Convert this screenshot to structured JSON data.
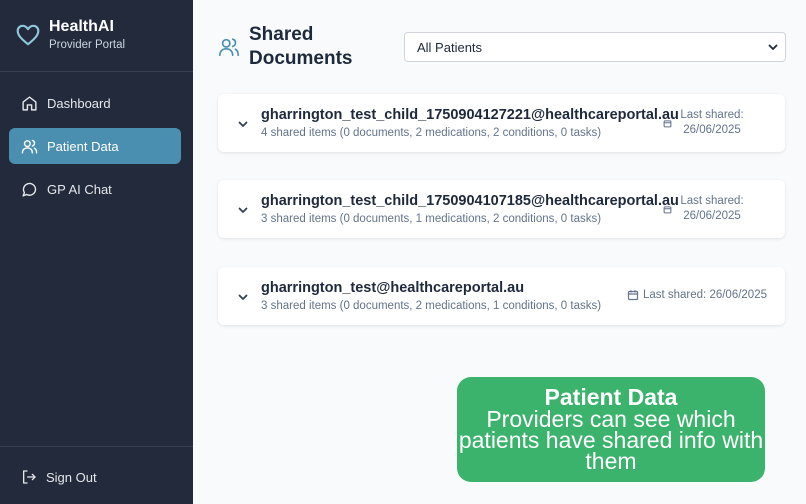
{
  "brand": {
    "name": "HealthAI",
    "subtitle": "Provider Portal"
  },
  "nav": {
    "dashboard": "Dashboard",
    "patient_data": "Patient Data",
    "gp_ai_chat": "GP AI Chat",
    "sign_out": "Sign Out"
  },
  "header": {
    "title": "Shared Documents"
  },
  "filter": {
    "selected": "All Patients"
  },
  "patients": [
    {
      "email": "gharrington_test_child_1750904127221@healthcareportal.au",
      "summary": "4 shared items (0 documents, 2 medications, 2 conditions, 0 tasks)",
      "shared_label": "Last shared:",
      "shared_date": "26/06/2025"
    },
    {
      "email": "gharrington_test_child_1750904107185@healthcareportal.au",
      "summary": "3 shared items (0 documents, 1 medications, 2 conditions, 0 tasks)",
      "shared_label": "Last shared:",
      "shared_date": "26/06/2025"
    },
    {
      "email": "gharrington_test@healthcareportal.au",
      "summary": "3 shared items (0 documents, 2 medications, 1 conditions, 0 tasks)",
      "shared_full": "Last shared: 26/06/2025"
    }
  ],
  "callout": {
    "title": "Patient Data",
    "body": "Providers can see which patients have shared info with them"
  },
  "colors": {
    "sidebar_bg": "#222a3b",
    "active_nav": "#4b8fb0",
    "accent": "#4b8fb0",
    "callout_bg": "#3cb36c",
    "page_bg": "#f8fafc"
  },
  "icons": {
    "brand": "heart-icon",
    "dashboard": "home-icon",
    "patient_data": "users-icon",
    "chat": "message-circle-icon",
    "sign_out": "log-out-icon",
    "header": "users-icon",
    "row_toggle": "chevron-down-icon",
    "date": "calendar-icon"
  }
}
